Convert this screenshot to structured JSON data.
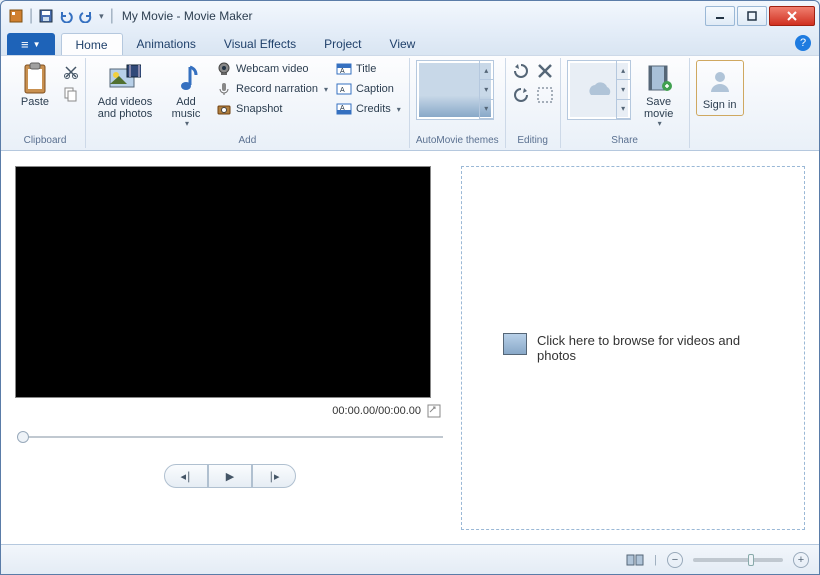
{
  "titlebar": {
    "title": "My Movie - Movie Maker"
  },
  "tabs": {
    "file_icon": "≡",
    "items": [
      "Home",
      "Animations",
      "Visual Effects",
      "Project",
      "View"
    ],
    "active": "Home"
  },
  "ribbon": {
    "clipboard": {
      "label": "Clipboard",
      "paste": "Paste"
    },
    "add": {
      "label": "Add",
      "add_media": "Add videos and photos",
      "add_music": "Add music",
      "webcam": "Webcam video",
      "narration": "Record narration",
      "snapshot": "Snapshot",
      "title": "Title",
      "caption": "Caption",
      "credits": "Credits"
    },
    "automovie": {
      "label": "AutoMovie themes"
    },
    "editing": {
      "label": "Editing"
    },
    "share": {
      "label": "Share",
      "save": "Save movie",
      "signin": "Sign in"
    }
  },
  "preview": {
    "timecode": "00:00.00/00:00.00"
  },
  "storyboard": {
    "hint": "Click here to browse for videos and photos"
  },
  "status": {
    "minus": "−",
    "plus": "+"
  }
}
